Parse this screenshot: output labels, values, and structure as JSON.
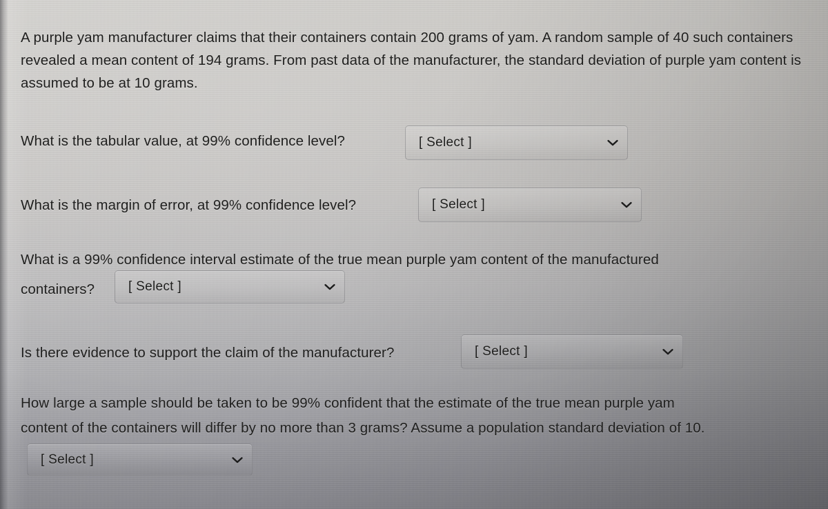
{
  "screen": {
    "background_top_hex": "#cfcdc9",
    "background_bottom_hex": "#8e8e95",
    "text_hex": "#20201f"
  },
  "problem": {
    "paragraph": "A purple yam manufacturer claims that their containers contain 200 grams of yam. A random sample of 40 such containers revealed a mean content of 194 grams. From past data of the manufacturer, the standard deviation of purple yam content is assumed to be at 10 grams.",
    "claimed_content_grams": 200,
    "sample_size": 40,
    "sample_mean_grams": 194,
    "population_sd_grams": 10,
    "confidence_level": "99%"
  },
  "questions": [
    {
      "id": "tabular-value",
      "text": "What is the tabular value, at 99% confidence level?",
      "select_label": "[ Select ]"
    },
    {
      "id": "margin-of-error",
      "text": "What is the margin of error, at 99% confidence level?",
      "select_label": "[ Select ]"
    },
    {
      "id": "confidence-interval",
      "text_line1": "What is a 99% confidence interval estimate of the true mean purple yam content of the manufactured",
      "text_line2": "containers?",
      "select_label": "[ Select ]"
    },
    {
      "id": "evidence-for-claim",
      "text": "Is there evidence to support the claim of the manufacturer?",
      "select_label": "[ Select ]"
    },
    {
      "id": "sample-size",
      "text_line1": "How large a sample should be taken to be 99% confident that the estimate of the true mean purple yam",
      "text_line2": "content of the containers will differ by no more than 3 grams? Assume a population standard deviation of 10.",
      "select_label": "[ Select ]"
    }
  ],
  "icons": {
    "chevron_down": "chevron-down-icon"
  }
}
